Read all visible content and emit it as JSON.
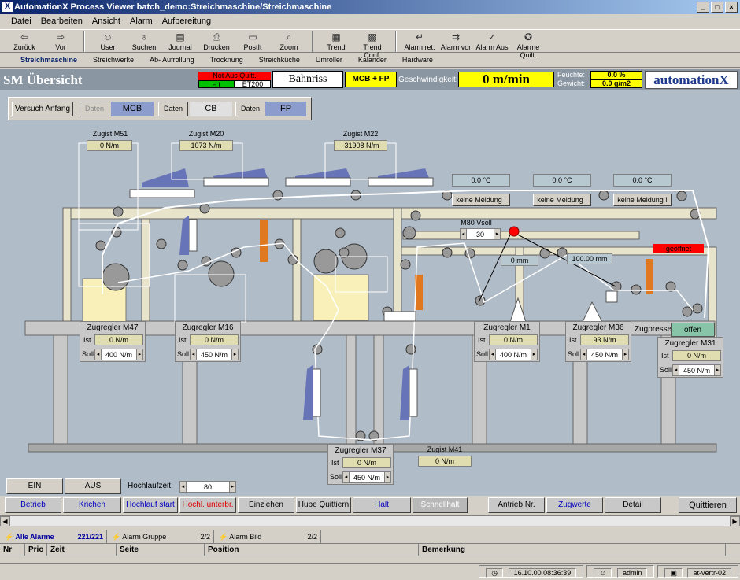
{
  "window": {
    "title": "AutomationX Process Viewer batch_demo:Streichmaschine/Streichmaschine"
  },
  "menu": [
    "Datei",
    "Bearbeiten",
    "Ansicht",
    "Alarm",
    "Aufbereitung"
  ],
  "toolbar": [
    {
      "label": "Zurück",
      "icon": "arrow-left-icon"
    },
    {
      "label": "Vor",
      "icon": "arrow-right-icon"
    },
    {
      "label": "User",
      "icon": "user-icon"
    },
    {
      "label": "Suchen",
      "icon": "binoculars-icon"
    },
    {
      "label": "Journal",
      "icon": "journal-icon"
    },
    {
      "label": "Drucken",
      "icon": "printer-icon"
    },
    {
      "label": "PostIt",
      "icon": "postit-icon"
    },
    {
      "label": "Zoom",
      "icon": "zoom-icon"
    },
    {
      "label": "Trend",
      "icon": "trend-icon"
    },
    {
      "label": "Trend Conf.",
      "icon": "trend-conf-icon"
    },
    {
      "label": "Alarm ret.",
      "icon": "alarm-return-icon"
    },
    {
      "label": "Alarm vor",
      "icon": "alarm-forward-icon"
    },
    {
      "label": "Alarm Aus",
      "icon": "alarm-off-icon"
    },
    {
      "label": "Alarme Quilt.",
      "icon": "alarm-quit-icon"
    }
  ],
  "nav": [
    "Streichmaschine",
    "Streichwerke",
    "Ab- Aufrollung",
    "Trocknung",
    "Streichküche",
    "Umroller",
    "Kalander",
    "Hardware"
  ],
  "header": {
    "title": "SM Übersicht",
    "notaus": "Not Aus Quitt.",
    "h1": "H1",
    "et200": "ET200",
    "bahnriss": "Bahnriss",
    "mcbfp": "MCB + FP",
    "speed_label": "Geschwindigkeit:",
    "speed": "0 m/min",
    "feuchte_label": "Feuchte:",
    "feuchte": "0.0 %",
    "gewicht_label": "Gewicht:",
    "gewicht": "0.0 g/m2",
    "logo": "automationX"
  },
  "controls": {
    "versuch": "Versuch Anfang",
    "daten1": "Daten",
    "mcb": "MCB",
    "daten2": "Daten",
    "cb": "CB",
    "daten3": "Daten",
    "fp": "FP"
  },
  "zugist": [
    {
      "name": "Zugist M51",
      "value": "0 N/m"
    },
    {
      "name": "Zugist M20",
      "value": "1073 N/m"
    },
    {
      "name": "Zugist M22",
      "value": "-31908 N/m"
    },
    {
      "name": "Zugist M41",
      "value": "0 N/m"
    }
  ],
  "temps": [
    {
      "temp": "0.0 °C",
      "msg": "keine Meldung !"
    },
    {
      "temp": "0.0 °C",
      "msg": "keine Meldung !"
    },
    {
      "temp": "0.0 °C",
      "msg": "keine Meldung !"
    }
  ],
  "m80": {
    "label": "M80 Vsoll",
    "value": "30",
    "mm1": "0 mm",
    "mm2": "100.00 mm"
  },
  "geoeffnet": "geöffnet",
  "zugpresse": {
    "label": "Zugpresse",
    "state": "offen"
  },
  "zugregler": [
    {
      "name": "Zugregler M47",
      "ist": "0 N/m",
      "soll": "400 N/m"
    },
    {
      "name": "Zugregler M16",
      "ist": "0 N/m",
      "soll": "450 N/m"
    },
    {
      "name": "Zugregler M1",
      "ist": "0 N/m",
      "soll": "400 N/m"
    },
    {
      "name": "Zugregler M36",
      "ist": "93 N/m",
      "soll": "450 N/m"
    },
    {
      "name": "Zugregler M31",
      "ist": "0 N/m",
      "soll": "450 N/m"
    },
    {
      "name": "Zugregler M37",
      "ist": "0 N/m",
      "soll": "450 N/m"
    }
  ],
  "ist_label": "Ist",
  "soll_label": "Soll",
  "ein": "EIN",
  "aus": "AUS",
  "hochlauf": {
    "label": "Hochlaufzeit",
    "value": "80"
  },
  "bottom": [
    {
      "label": "Betrieb",
      "color": "#0000c0"
    },
    {
      "label": "Krichen",
      "color": "#0000c0"
    },
    {
      "label": "Hochlauf start",
      "color": "#0000c0"
    },
    {
      "label": "Hochl. unterbr.",
      "color": "#e00000"
    },
    {
      "label": "Einziehen",
      "color": "#000000"
    },
    {
      "label": "Hupe Quittiern",
      "color": "#000000"
    },
    {
      "label": "Halt",
      "color": "#0000c0"
    },
    {
      "label": "Schnellhalt",
      "color": "#ffffff"
    },
    {
      "label": "Antrieb Nr.",
      "color": "#000000"
    },
    {
      "label": "Zugwerte",
      "color": "#0000c0"
    },
    {
      "label": "Detail",
      "color": "#000000"
    },
    {
      "label": "Quittieren",
      "color": "#000000"
    }
  ],
  "alarm": {
    "alle": "Alle Alarme",
    "count": "221/221",
    "gruppe": "Alarm Gruppe",
    "gruppe_count": "2/2",
    "bild": "Alarm Bild",
    "bild_count": "2/2"
  },
  "columns": [
    "Nr",
    "Prio",
    "Zeit",
    "Seite",
    "Position",
    "Bemerkung"
  ],
  "status": {
    "time": "16.10.00 08:36:39",
    "user": "admin",
    "station": "at-vertr-02"
  }
}
